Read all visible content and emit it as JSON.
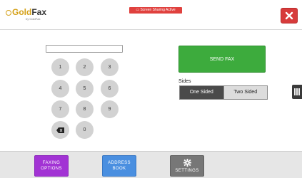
{
  "header": {
    "logo_prefix": "Gold",
    "logo_suffix": "Fax",
    "logo_sub": "by GoldFax",
    "share_badge": "Screen Sharing Active"
  },
  "dialer": {
    "display_value": "",
    "keys": [
      "1",
      "2",
      "3",
      "4",
      "5",
      "6",
      "7",
      "8",
      "9",
      "0"
    ]
  },
  "actions": {
    "send_fax": "SEND FAX",
    "sides_label": "Sides",
    "sides_options": [
      "One Sided",
      "Two Sided"
    ],
    "sides_selected": "One Sided"
  },
  "footer": {
    "faxing_options_line1": "FAXING",
    "faxing_options_line2": "OPTIONS",
    "address_book_line1": "ADDRESS",
    "address_book_line2": "BOOK",
    "settings": "SETTINGS"
  },
  "icons": [
    "close-icon",
    "backspace-icon",
    "gear-icon",
    "sidebar-handle-icon",
    "screen-share-icon"
  ],
  "colors": {
    "send_fax": "#3dab3d",
    "faxing_options": "#a233d4",
    "address_book": "#4a8fe0",
    "settings": "#777777",
    "close": "#d73b3b",
    "badge": "#e0413e"
  }
}
